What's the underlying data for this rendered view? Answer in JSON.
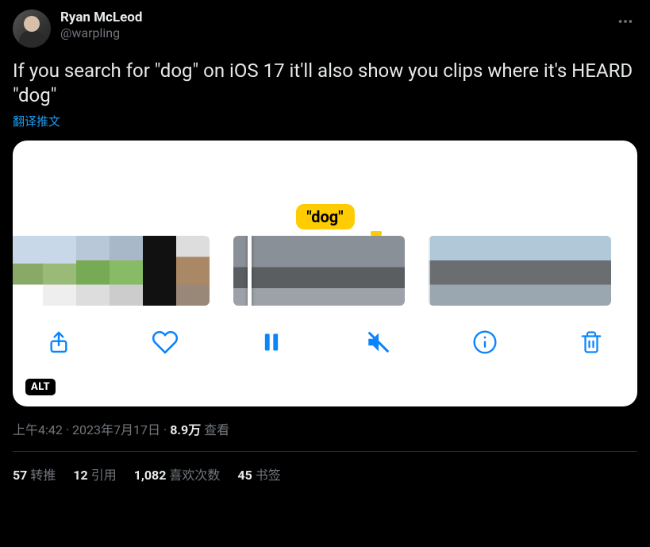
{
  "user": {
    "display_name": "Ryan McLeod",
    "handle": "@warpling"
  },
  "tweet": {
    "text": "If you search for \"dog\" on iOS 17 it'll also show you clips where it's HEARD \"dog\"",
    "translate_label": "翻译推文"
  },
  "media": {
    "search_tag": "\"dog\"",
    "alt_badge": "ALT"
  },
  "meta": {
    "time": "上午4:42",
    "date": "2023年7月17日",
    "views_count": "8.9万",
    "views_label": "查看"
  },
  "stats": {
    "retweets": {
      "count": "57",
      "label": "转推"
    },
    "quotes": {
      "count": "12",
      "label": "引用"
    },
    "likes": {
      "count": "1,082",
      "label": "喜欢次数"
    },
    "bookmarks": {
      "count": "45",
      "label": "书签"
    }
  }
}
